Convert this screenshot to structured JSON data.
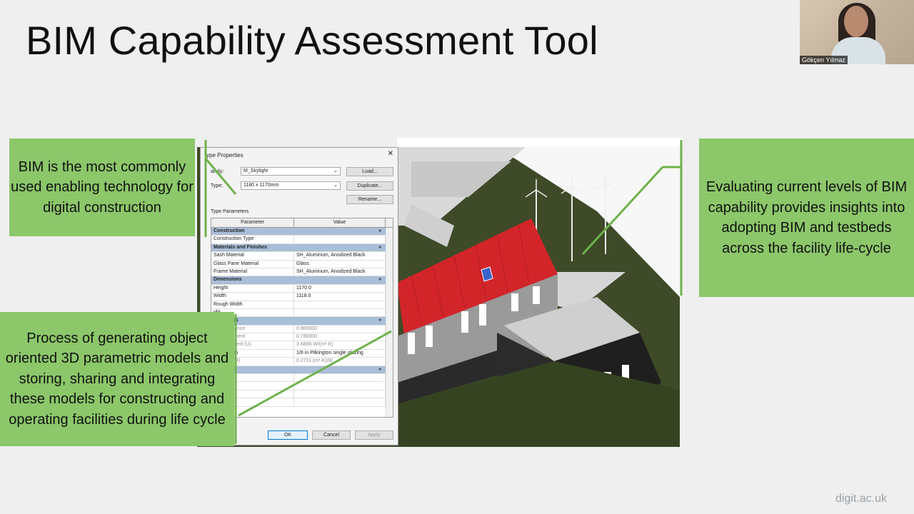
{
  "slide": {
    "title": "BIM Capability Assessment Tool",
    "footer": "digit.ac.uk"
  },
  "video": {
    "participant_name": "Gökçen Yılmaz"
  },
  "callouts": {
    "left": "BIM is the most commonly used enabling technology for digital construction",
    "right": "Evaluating current levels of BIM capability provides insights into adopting BIM and testbeds across the facility life-cycle",
    "bottom": "Process of generating object oriented 3D parametric models and storing, sharing and integrating these models for constructing and operating facilities during life cycle"
  },
  "dialog": {
    "title": "ype Properties",
    "close": "✕",
    "family_label": "amily:",
    "family_value": "M_Skylight",
    "type_label": "Type:",
    "type_value": "1180 x 1170mm",
    "load_button": "Load...",
    "duplicate_button": "Duplicate...",
    "rename_button": "Rename...",
    "type_parameters_label": "Type Parameters",
    "col_parameter": "Parameter",
    "col_value": "Value",
    "rows": [
      {
        "kind": "group",
        "name": "Construction",
        "value": "»"
      },
      {
        "kind": "row",
        "name": "Construction Type",
        "value": ""
      },
      {
        "kind": "group",
        "name": "Materials and Finishes",
        "value": "»"
      },
      {
        "kind": "row",
        "name": "Sash Material",
        "value": "SH_Aluminum, Anodized Black"
      },
      {
        "kind": "row",
        "name": "Glass Pane Material",
        "value": "Glass"
      },
      {
        "kind": "row",
        "name": "Frame Material",
        "value": "SH_Aluminum, Anodized Black"
      },
      {
        "kind": "group",
        "name": "Dimensions",
        "value": "»"
      },
      {
        "kind": "row",
        "name": "Height",
        "value": "1170.0"
      },
      {
        "kind": "row",
        "name": "Width",
        "value": "1118.0"
      },
      {
        "kind": "row",
        "name": "Rough Width",
        "value": ""
      },
      {
        "kind": "row",
        "name": "ght",
        "value": ""
      },
      {
        "kind": "group",
        "name": "Properties",
        "value": "»"
      },
      {
        "kind": "grey",
        "name": "Transmittance",
        "value": "0.900000"
      },
      {
        "kind": "grey",
        "name": "ain Coefficient",
        "value": "0.780000"
      },
      {
        "kind": "grey",
        "name": "er Coefficient (U)",
        "value": "3.6886 W/(m²·K)"
      },
      {
        "kind": "row",
        "name": "onstruction",
        "value": "1/8 in Pilkington single glazing"
      },
      {
        "kind": "grey",
        "name": "sistance (R)",
        "value": "0.2711 (m²·K)/W"
      },
      {
        "kind": "group",
        "name": "ata",
        "value": "»"
      },
      {
        "kind": "row",
        "name": "ments",
        "value": ""
      },
      {
        "kind": "row",
        "name": "",
        "value": ""
      },
      {
        "kind": "row",
        "name": "",
        "value": ""
      },
      {
        "kind": "row",
        "name": "",
        "value": ""
      }
    ],
    "preview_button": "iew",
    "ok_button": "OK",
    "cancel_button": "Cancel",
    "apply_button": "Apply"
  }
}
